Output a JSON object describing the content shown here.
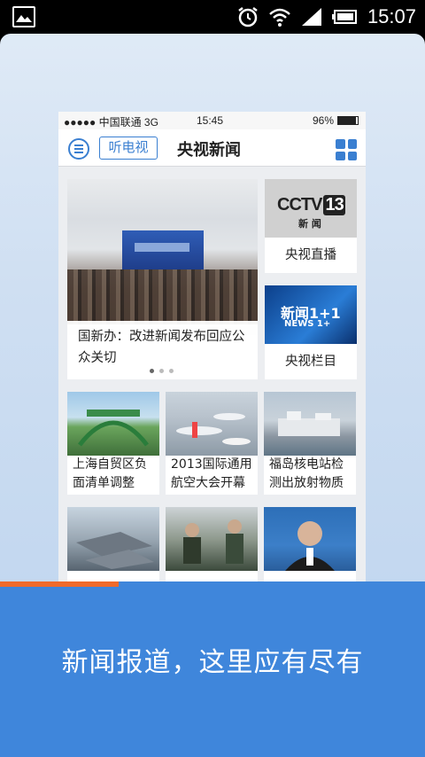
{
  "status_bar": {
    "time": "15:07",
    "icons": [
      "image-icon",
      "alarm-icon",
      "wifi-icon",
      "signal-icon",
      "battery-icon"
    ]
  },
  "phone": {
    "ios_status": {
      "carrier": "●●●●● 中国联通  3G",
      "time": "15:45",
      "battery": "96%"
    },
    "app_bar": {
      "listen_label": "听电视",
      "title": "央视新闻"
    },
    "hero": {
      "caption": "国新办：改进新闻发布回应公众关切",
      "slides_total": 3,
      "slide_active": 1
    },
    "side_cards": [
      {
        "label": "央视直播",
        "logo_text": "CCTV",
        "logo_num": "13",
        "logo_sub": "新 闻"
      },
      {
        "label": "央视栏目",
        "logo_text": "新闻1+1",
        "logo_sub": "NEWS 1+"
      }
    ],
    "tiles": [
      {
        "caption": "上海自贸区负面清单调整"
      },
      {
        "caption": "2013国际通用航空大会开幕"
      },
      {
        "caption": "福岛核电站检测出放射物质"
      }
    ]
  },
  "promo": {
    "text": "新闻报道，这里应有尽有",
    "progress": 0.28
  },
  "colors": {
    "accent": "#3a7fd1",
    "promo_bg": "#3f86db",
    "progress": "#ef6a2b"
  }
}
